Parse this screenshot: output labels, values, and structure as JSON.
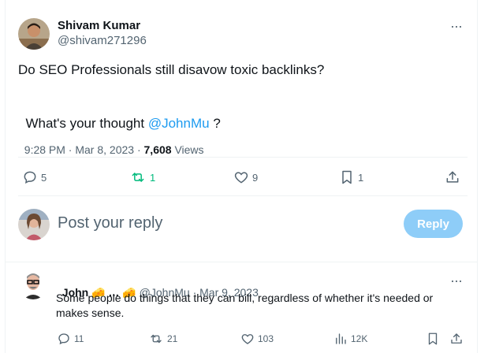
{
  "tweet": {
    "author_name": "Shivam Kumar",
    "author_handle": "@shivam271296",
    "text_line1": "Do SEO Professionals still disavow toxic backlinks?",
    "text_line2_prefix": "What's your thought ",
    "text_line2_mention": "@JohnMu",
    "text_line2_suffix": " ?",
    "timestamp": "9:28 PM · Mar 8, 2023 · ",
    "views_count": "7,608",
    "views_label": " Views",
    "actions": {
      "replies": "5",
      "retweets": "1",
      "likes": "9",
      "bookmarks": "1"
    },
    "more_label": "···"
  },
  "compose": {
    "placeholder": "Post your reply",
    "reply_button": "Reply"
  },
  "reply": {
    "author_name": "John 🧀 … 🧀",
    "author_handle": "@JohnMu",
    "separator": "·",
    "date": "Mar 9, 2023",
    "text": "Some people do things that they can bill, regardless of whether it's needed or makes sense.",
    "actions": {
      "replies": "11",
      "retweets": "21",
      "likes": "103",
      "views": "12K"
    },
    "more_label": "···"
  },
  "colors": {
    "accent": "#1d9bf0",
    "retweet_green": "#00ba7c",
    "reply_button_bg": "#8ecdf8",
    "muted_text": "#536471"
  }
}
